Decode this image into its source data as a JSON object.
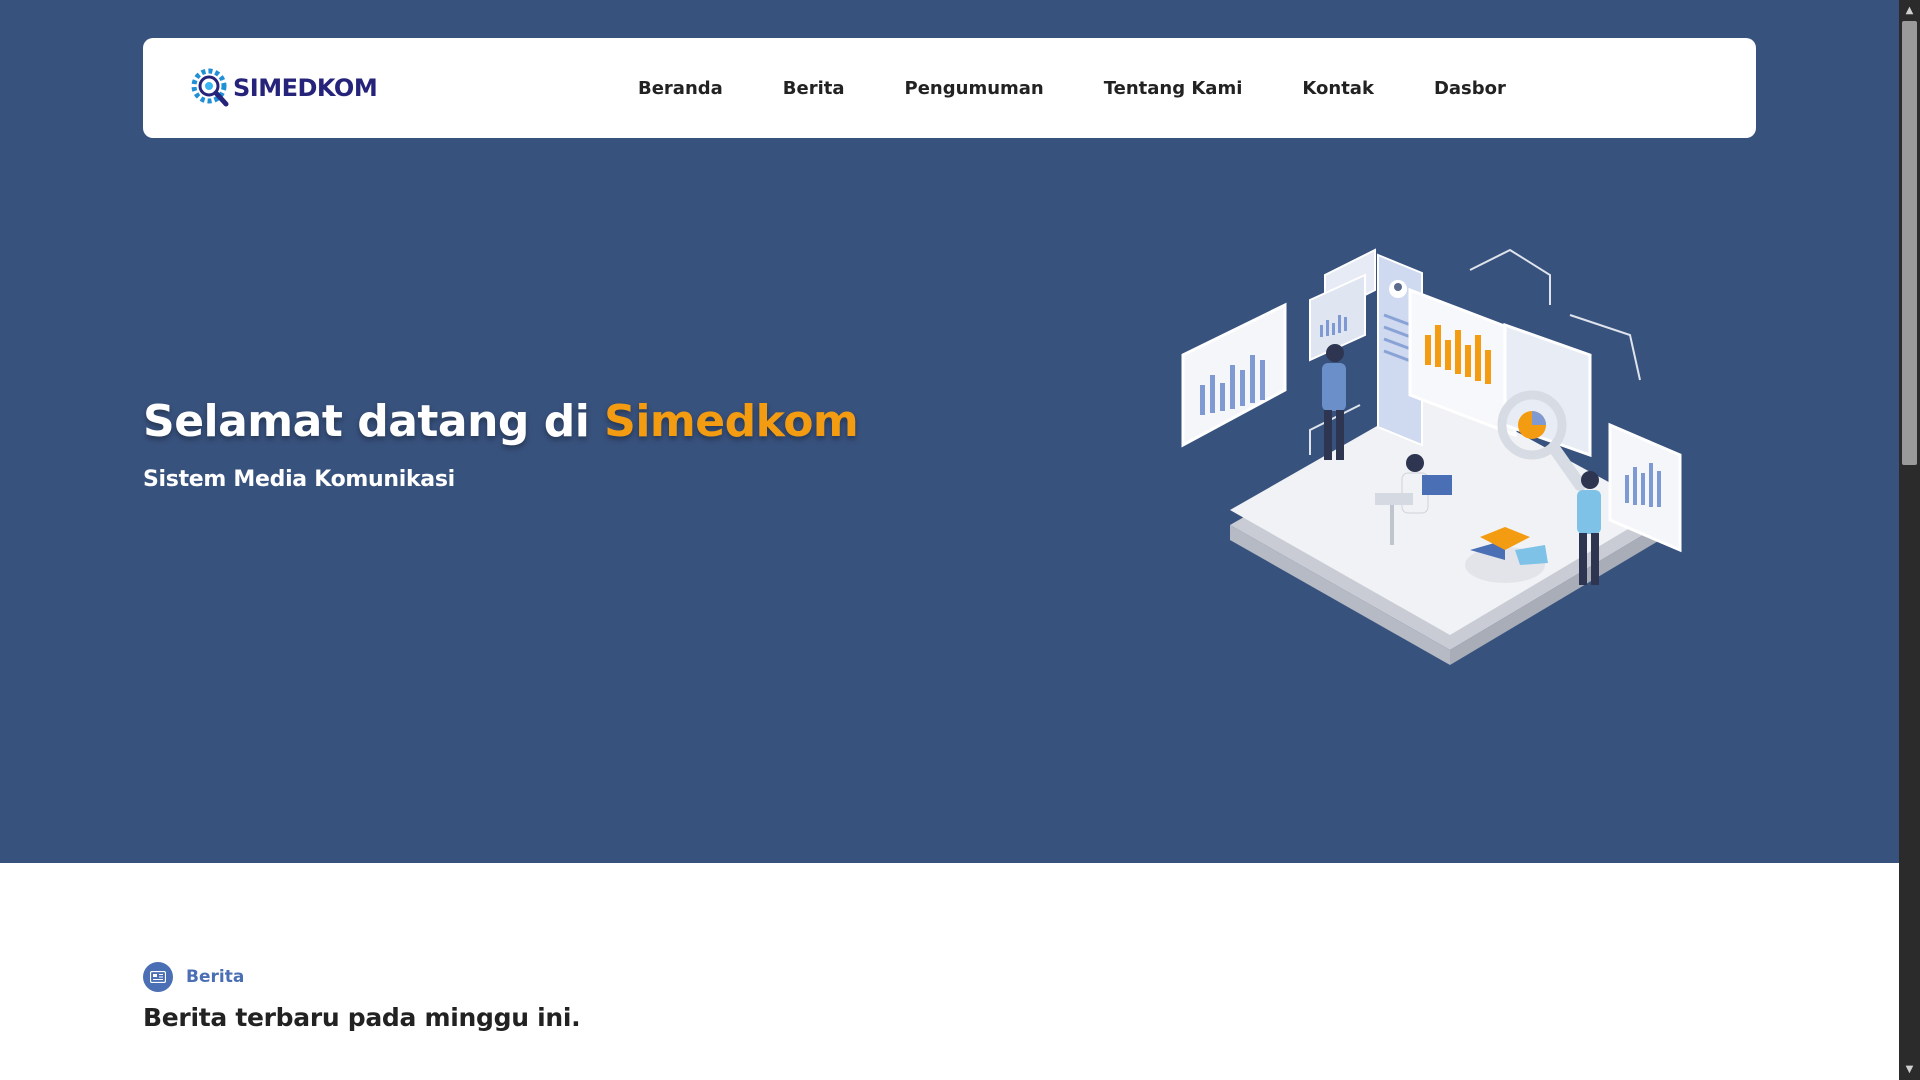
{
  "brand": {
    "name": "SIMEDKOM"
  },
  "nav": {
    "items": [
      {
        "label": "Beranda"
      },
      {
        "label": "Berita"
      },
      {
        "label": "Pengumuman"
      },
      {
        "label": "Tentang Kami"
      },
      {
        "label": "Kontak"
      },
      {
        "label": "Dasbor"
      }
    ]
  },
  "hero": {
    "title_prefix": "Selamat datang di ",
    "title_accent": "Simedkom",
    "subtitle": "Sistem Media Komunikasi"
  },
  "section": {
    "tag": "Berita",
    "heading": "Berita terbaru pada minggu ini."
  },
  "colors": {
    "hero_bg": "#38527e",
    "accent": "#f39c12",
    "brand_text": "#26237a",
    "tag": "#4b6fb4"
  },
  "icons": {
    "logo": "gear-magnifier-logo-icon",
    "section": "newspaper-icon",
    "scroll_up": "scroll-up-arrow-icon",
    "scroll_down": "scroll-down-arrow-icon"
  }
}
